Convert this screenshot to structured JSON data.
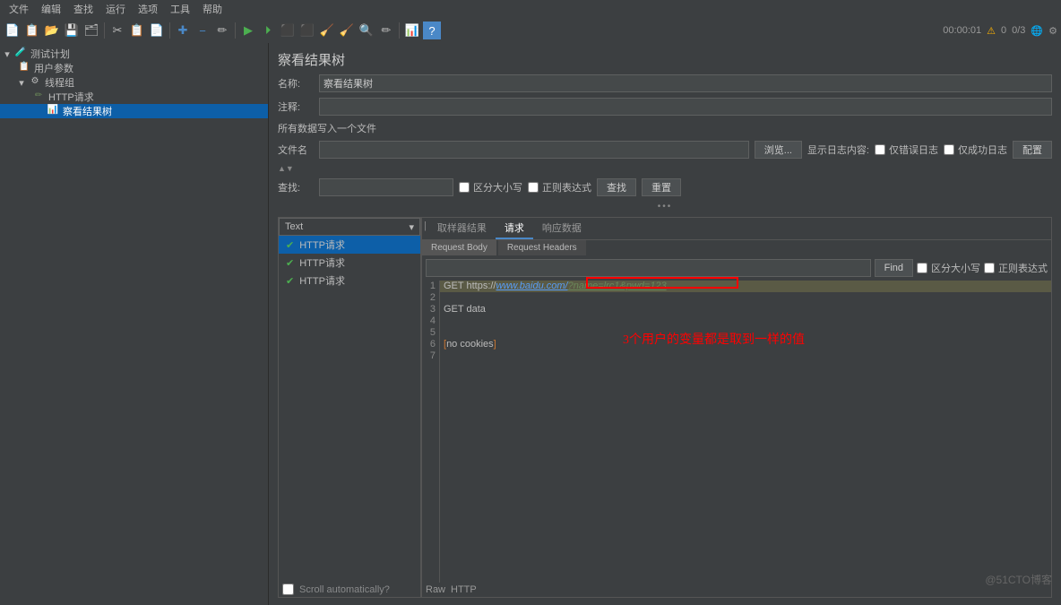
{
  "menu": {
    "file": "文件",
    "edit": "编辑",
    "search": "查找",
    "run": "运行",
    "options": "选项",
    "tools": "工具",
    "help": "帮助"
  },
  "stats": {
    "time": "00:00:01",
    "warn": "⚠",
    "active": "0",
    "total": "0/3"
  },
  "tree": {
    "plan": "测试计划",
    "params": "用户参数",
    "group": "线程组",
    "http": "HTTP请求",
    "tree": "察看结果树"
  },
  "panel": {
    "title": "察看结果树",
    "name_lbl": "名称:",
    "name_val": "察看结果树",
    "comment_lbl": "注释:",
    "file_title": "所有数据写入一个文件",
    "filename_lbl": "文件名",
    "browse": "浏览...",
    "log_lbl": "显示日志内容:",
    "err_only": "仅错误日志",
    "ok_only": "仅成功日志",
    "config": "配置",
    "search_lbl": "查找:",
    "case": "区分大小写",
    "regex": "正则表达式",
    "find": "查找",
    "reset": "重置"
  },
  "results": {
    "dropdown": "Text",
    "items": [
      "HTTP请求",
      "HTTP请求",
      "HTTP请求"
    ],
    "tabs": {
      "sampler": "取样器结果",
      "request": "请求",
      "response": "响应数据"
    },
    "subtabs": {
      "body": "Request Body",
      "headers": "Request Headers"
    },
    "find_btn": "Find",
    "case2": "区分大小写",
    "regex2": "正则表达式"
  },
  "code": {
    "l1a": "GET https://",
    "l1b": "www.baidu.com/",
    "l1c": "?name=lrc1&pwd=123",
    "l3": "GET data",
    "l6a": "[",
    "l6b": "no cookies",
    "l6c": "]"
  },
  "annotation": "3个用户的变量都是取到一样的值",
  "bottom": {
    "scroll": "Scroll automatically?",
    "raw": "Raw",
    "http": "HTTP"
  },
  "watermark": "@51CTO博客"
}
